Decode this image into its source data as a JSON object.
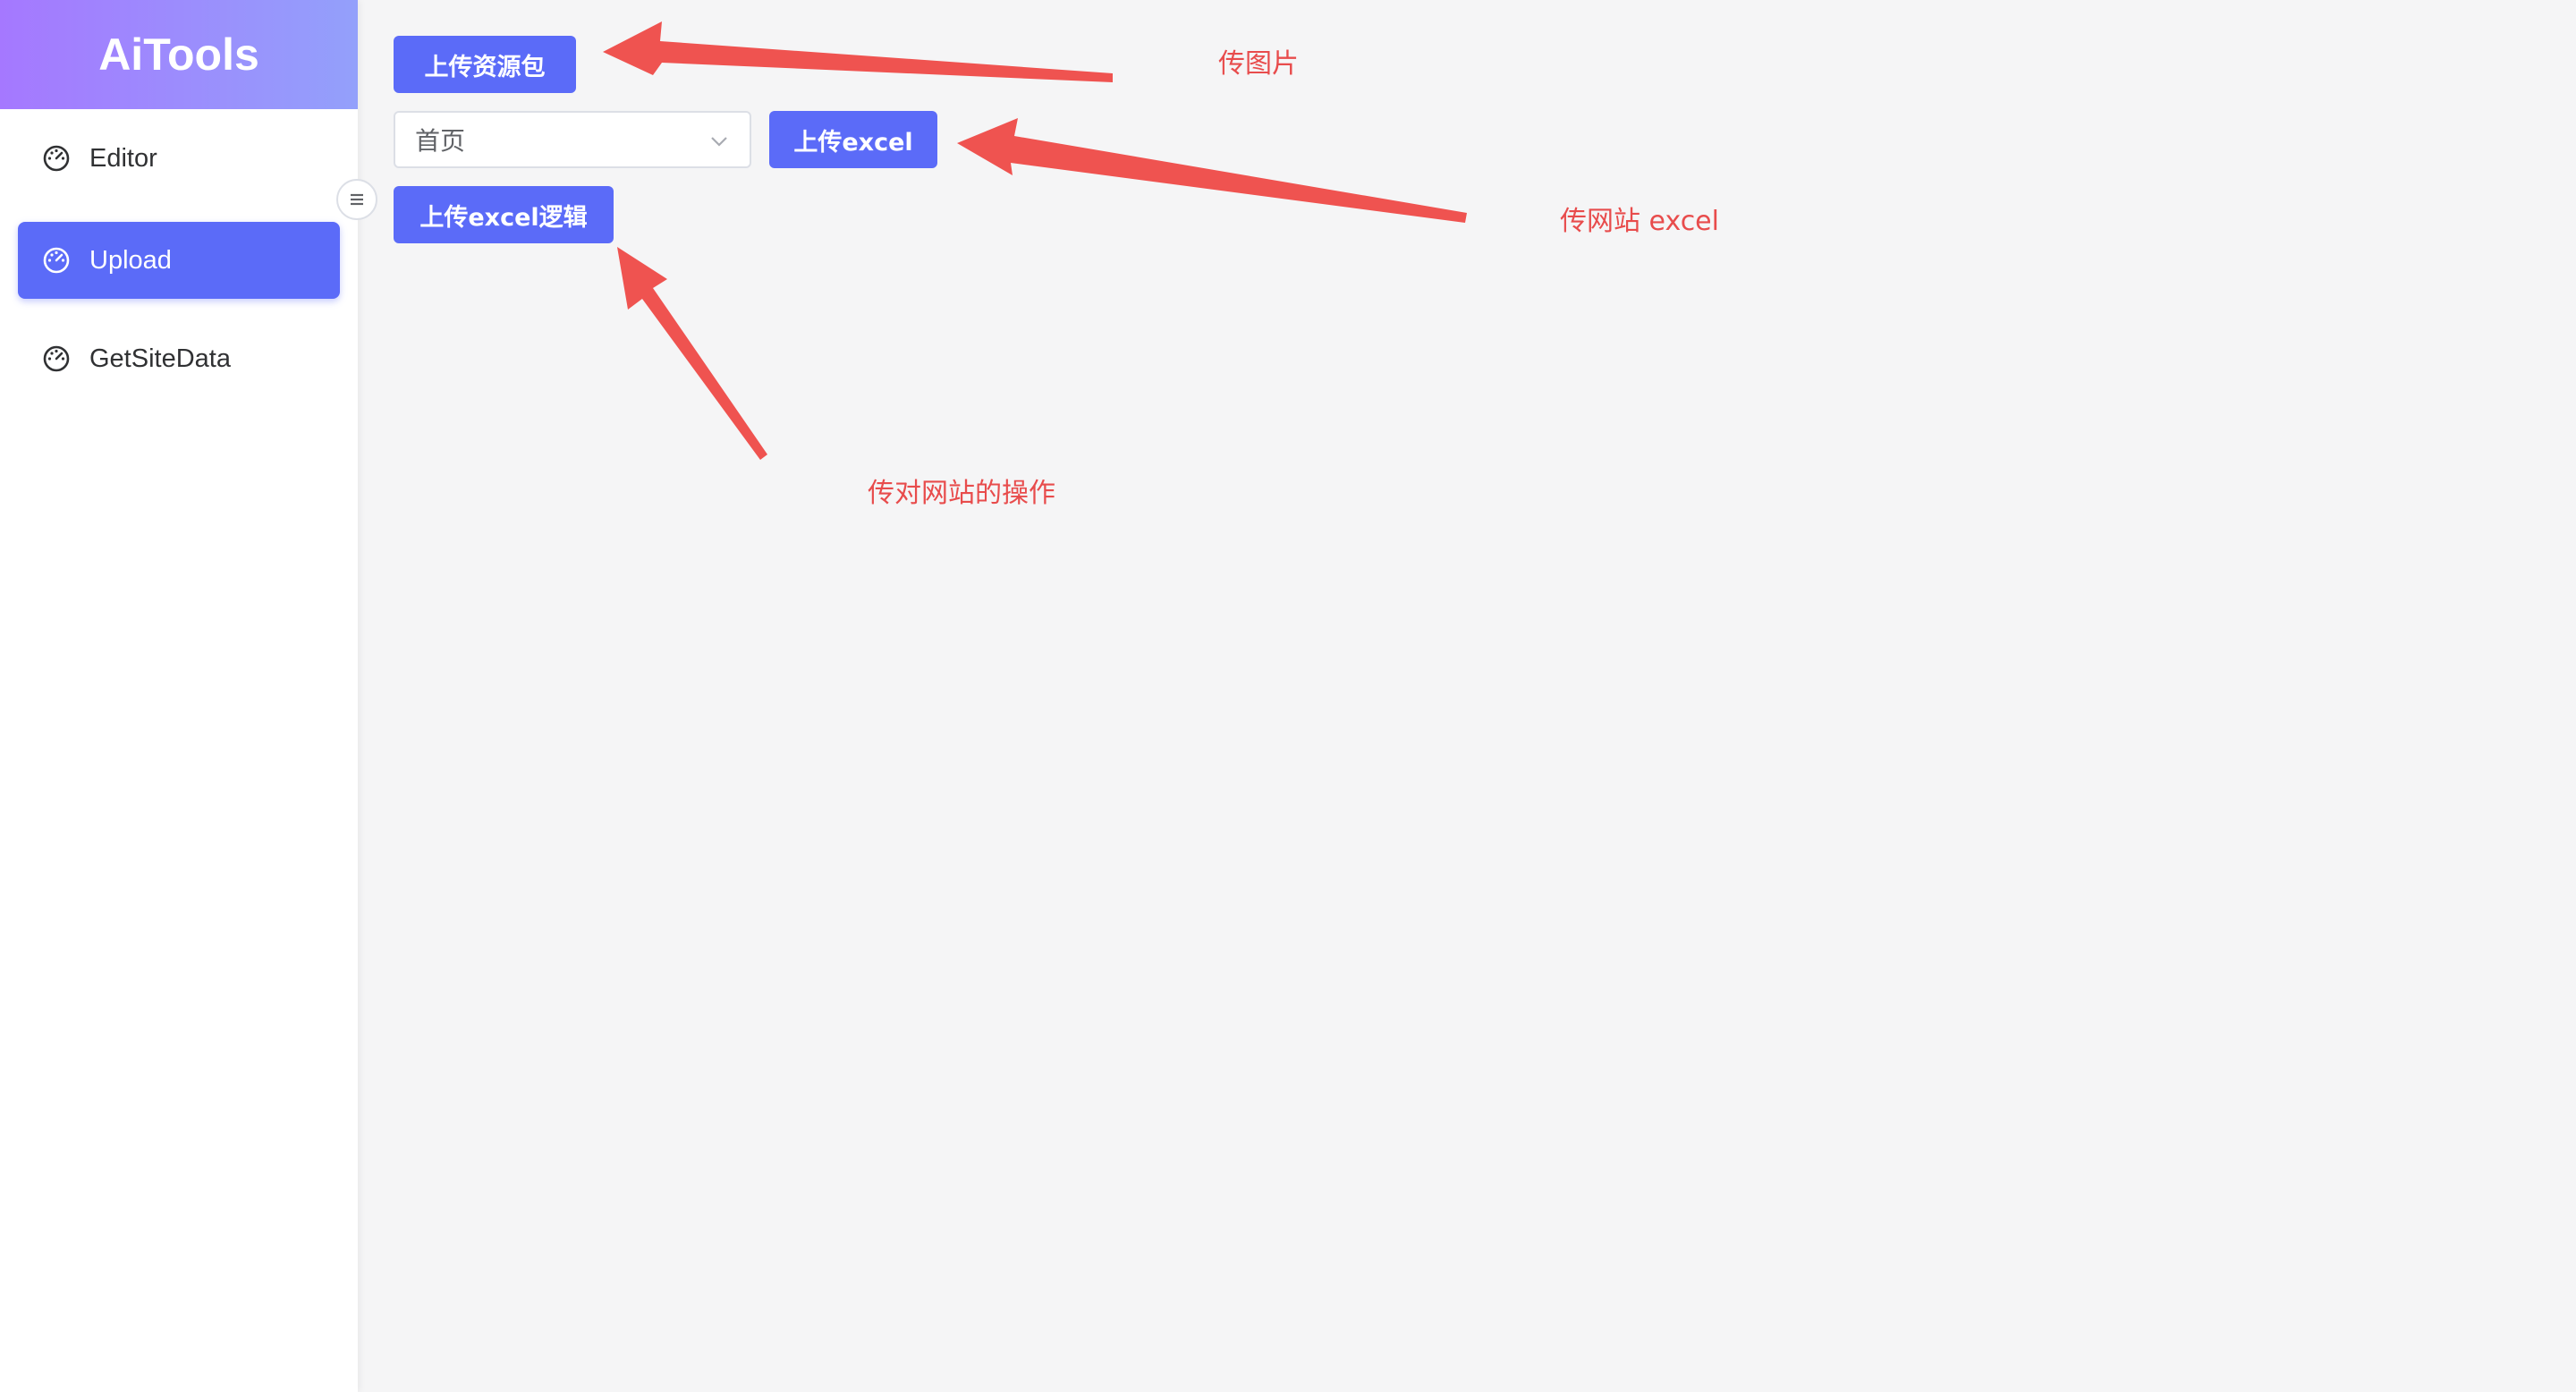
{
  "sidebar": {
    "brand": "AiTools",
    "items": [
      {
        "label": "Editor",
        "icon": "dashboard-icon",
        "active": false
      },
      {
        "label": "Upload",
        "icon": "dashboard-icon",
        "active": true
      },
      {
        "label": "GetSiteData",
        "icon": "dashboard-icon",
        "active": false
      }
    ],
    "collapse_icon": "menu-icon"
  },
  "main": {
    "upload_package_button": "上传资源包",
    "page_select": {
      "value": "首页"
    },
    "upload_excel_button": "上传excel",
    "upload_excel_logic_button": "上传excel逻辑"
  },
  "annotations": {
    "upload_images_note": "传图片",
    "upload_site_excel_note": "传网站 excel",
    "upload_site_actions_note": "传对网站的操作"
  },
  "colors": {
    "accent": "#5b6bf8",
    "brand_gradient_start": "#a578ff",
    "brand_gradient_end": "#93a0fb",
    "annotation": "#e84c4c",
    "background": "#f5f5f6"
  }
}
